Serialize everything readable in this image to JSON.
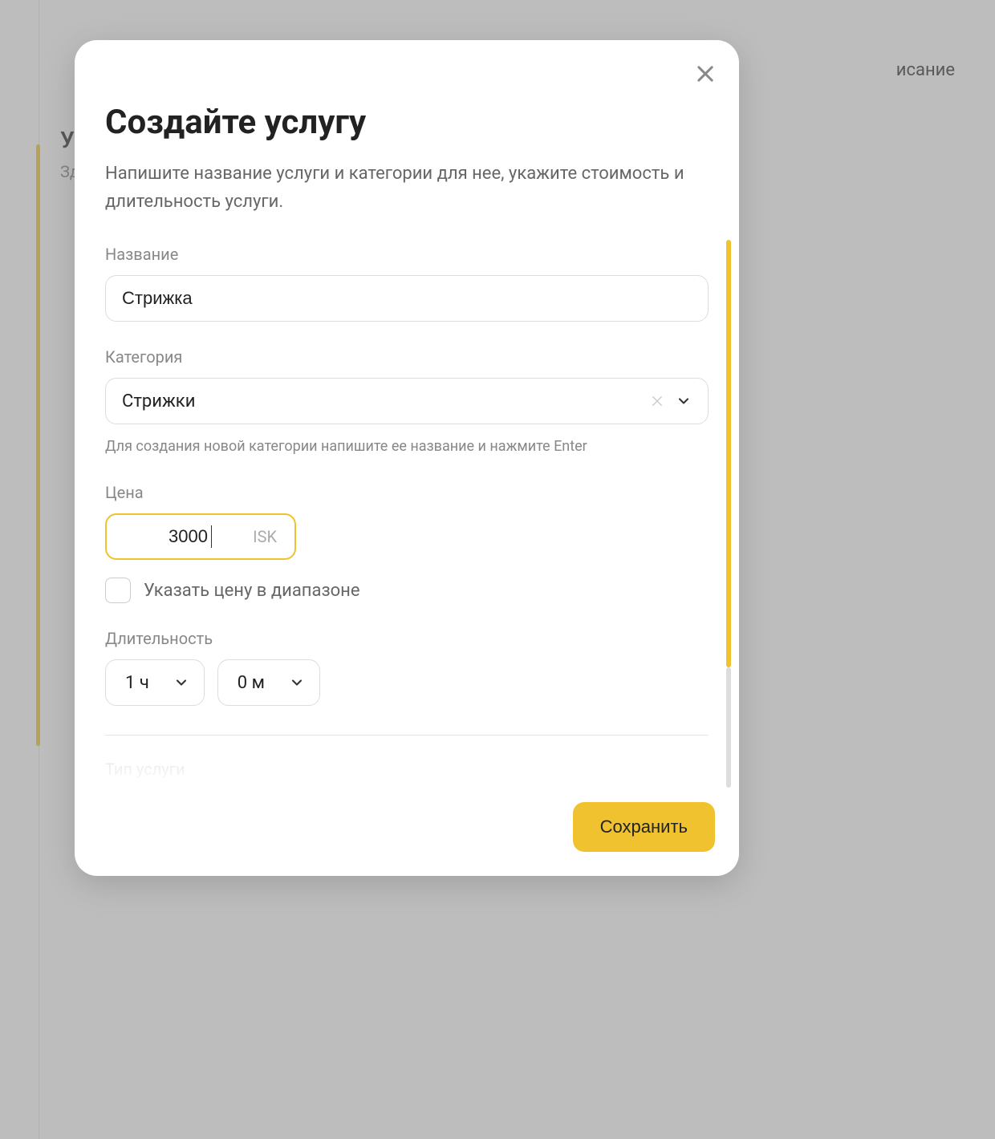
{
  "background": {
    "page_title_fragment": "У",
    "page_subtitle_fragment": "Зд",
    "tab_fragment": "исание"
  },
  "modal": {
    "title": "Создайте услугу",
    "subtitle": "Напишите название услуги и категории для нее, укажите стоимость и длительность услуги.",
    "fields": {
      "name": {
        "label": "Название",
        "value": "Стрижка"
      },
      "category": {
        "label": "Категория",
        "value": "Стрижки",
        "hint": "Для создания новой категории напишите ее название и нажмите Enter"
      },
      "price": {
        "label": "Цена",
        "value": "3000",
        "currency": "ISK",
        "range_checkbox_label": "Указать цену в диапазоне"
      },
      "duration": {
        "label": "Длительность",
        "hours": "1 ч",
        "minutes": "0 м"
      },
      "service_type": {
        "label_partial": "Тип услуги"
      }
    },
    "save_button": "Сохранить"
  }
}
